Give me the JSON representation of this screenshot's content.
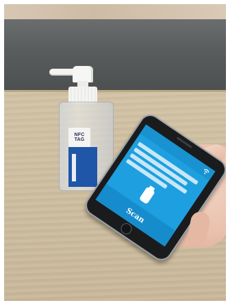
{
  "scene": {
    "bottle_label_text": "NFC TAG",
    "phone_screen": {
      "scan_button_label": "Scan"
    }
  },
  "icons": [
    "wifi-icon",
    "bottle-icon"
  ]
}
